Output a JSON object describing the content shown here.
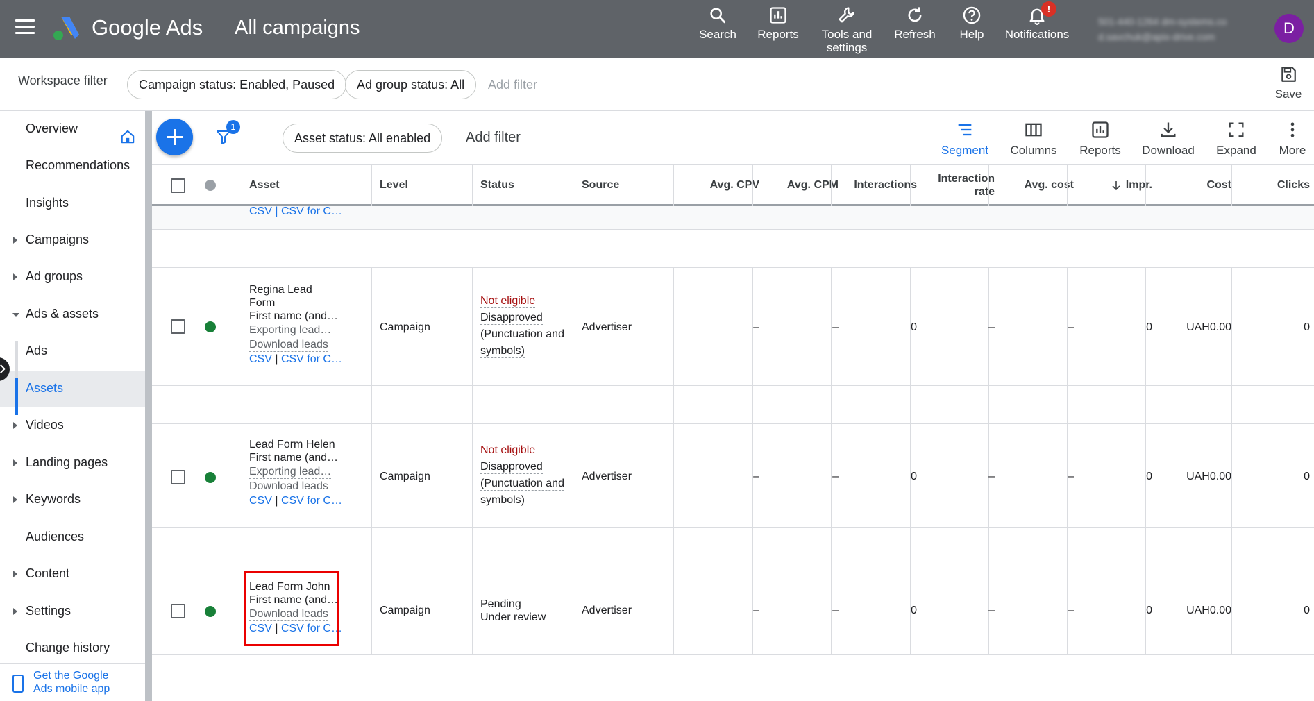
{
  "topbar": {
    "brand": "Google Ads",
    "page_title": "All campaigns",
    "actions": {
      "search": "Search",
      "reports": "Reports",
      "tools_line1": "Tools and",
      "tools_line2": "settings",
      "refresh": "Refresh",
      "help": "Help",
      "notifications": "Notifications",
      "notifications_badge": "!"
    },
    "account_line1": "501-440-1264 dm-systems.co",
    "account_line2": "d.savchuk@apix-drive.com",
    "avatar_letter": "D"
  },
  "workspace": {
    "label": "Workspace filter",
    "chip_campaign": "Campaign status: Enabled, Paused",
    "chip_adgroup": "Ad group status: All",
    "add_filter": "Add filter",
    "save": "Save"
  },
  "sidebar": {
    "overview": "Overview",
    "recommendations": "Recommendations",
    "insights": "Insights",
    "campaigns": "Campaigns",
    "ad_groups": "Ad groups",
    "ads_assets": "Ads & assets",
    "ads": "Ads",
    "assets": "Assets",
    "videos": "Videos",
    "landing_pages": "Landing pages",
    "keywords": "Keywords",
    "audiences": "Audiences",
    "content": "Content",
    "settings": "Settings",
    "change_history": "Change history",
    "app_promo_line1": "Get the Google",
    "app_promo_line2": "Ads mobile app"
  },
  "toolbar": {
    "filter_badge": "1",
    "asset_status_chip": "Asset status: All enabled",
    "add_filter": "Add filter",
    "segment": "Segment",
    "columns": "Columns",
    "reports": "Reports",
    "download": "Download",
    "expand": "Expand",
    "more": "More"
  },
  "table": {
    "headers": {
      "asset": "Asset",
      "level": "Level",
      "status": "Status",
      "source": "Source",
      "avg_cpv": "Avg. CPV",
      "avg_cpm": "Avg. CPM",
      "interactions": "Interactions",
      "interaction_rate_1": "Interaction",
      "interaction_rate_2": "rate",
      "avg_cost": "Avg. cost",
      "impr": "Impr.",
      "cost": "Cost",
      "clicks": "Clicks"
    },
    "partial_row_link": "CSV | CSV for C…",
    "rows": [
      {
        "name1": "Regina Lead",
        "name2": "Form",
        "line_first_name": "First name (and…",
        "line_exporting": "Exporting lead…",
        "line_download": "Download leads",
        "link_csv": "CSV",
        "link_sep": " | ",
        "link_csv_for": "CSV for C…",
        "level": "Campaign",
        "status_main": "Not eligible",
        "status_1": "Disapproved",
        "status_2": "(Punctuation and",
        "status_3": "symbols)",
        "source": "Advertiser",
        "avg_cpv": "–",
        "avg_cpm": "–",
        "interactions": "0",
        "interaction_rate": "–",
        "avg_cost": "–",
        "impr": "0",
        "cost": "UAH0.00",
        "clicks": "0"
      },
      {
        "name1": "Lead Form Helen",
        "line_first_name": "First name (and…",
        "line_exporting": "Exporting lead…",
        "line_download": "Download leads",
        "link_csv": "CSV",
        "link_sep": " | ",
        "link_csv_for": "CSV for C…",
        "level": "Campaign",
        "status_main": "Not eligible",
        "status_1": "Disapproved",
        "status_2": "(Punctuation and",
        "status_3": "symbols)",
        "source": "Advertiser",
        "avg_cpv": "–",
        "avg_cpm": "–",
        "interactions": "0",
        "interaction_rate": "–",
        "avg_cost": "–",
        "impr": "0",
        "cost": "UAH0.00",
        "clicks": "0"
      },
      {
        "name1": "Lead Form John",
        "line_first_name": "First name (and…",
        "line_download": "Download leads",
        "link_csv": "CSV",
        "link_sep": " | ",
        "link_csv_for": "CSV for C…",
        "level": "Campaign",
        "status_1": "Pending",
        "status_2": "Under review",
        "source": "Advertiser",
        "avg_cpv": "–",
        "avg_cpm": "–",
        "interactions": "0",
        "interaction_rate": "–",
        "avg_cost": "–",
        "impr": "0",
        "cost": "UAH0.00",
        "clicks": "0"
      }
    ]
  },
  "colors": {
    "topbar": "#5f6368",
    "accent": "#1a73e8",
    "enabled_dot": "#188038",
    "not_eligible": "#a50e0e",
    "highlight": "#ea0000"
  }
}
